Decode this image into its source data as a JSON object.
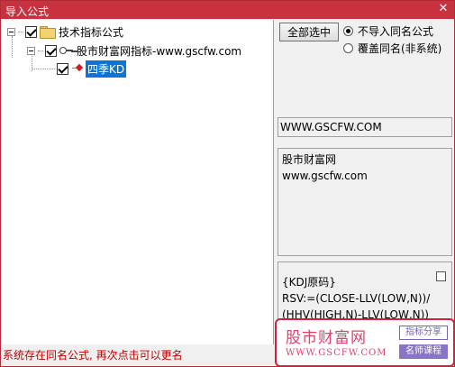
{
  "window": {
    "title": "导入公式",
    "close_glyph": "✕"
  },
  "tree": {
    "root_label": "技术指标公式",
    "group_label": "股市财富网指标-www.gscfw.com",
    "item_label": "四季KD"
  },
  "options": {
    "select_all_label": "全部选中",
    "radio_no_import": "不导入同名公式",
    "radio_overwrite": "覆盖同名(非系统)"
  },
  "details": {
    "url_value": "WWW.GSCFW.COM",
    "description_lines": [
      "股市财富网",
      "www.gscfw.com"
    ],
    "formula_lines": [
      "{KDJ原码}",
      "RSV:=(CLOSE-LLV(LOW,N))/",
      "(HHV(HIGH,N)-LLV(LOW,N))"
    ]
  },
  "watermark": {
    "name": "股市财富网",
    "url": "WWW.GSCFW.COM",
    "tag1": "指标分享",
    "tag2": "名师课程"
  },
  "status_text": "系统存在同名公式, 再次点击可以更名",
  "colors": {
    "title_bar": "#c8323f",
    "selection": "#0b74d6",
    "status": "#c00000"
  }
}
